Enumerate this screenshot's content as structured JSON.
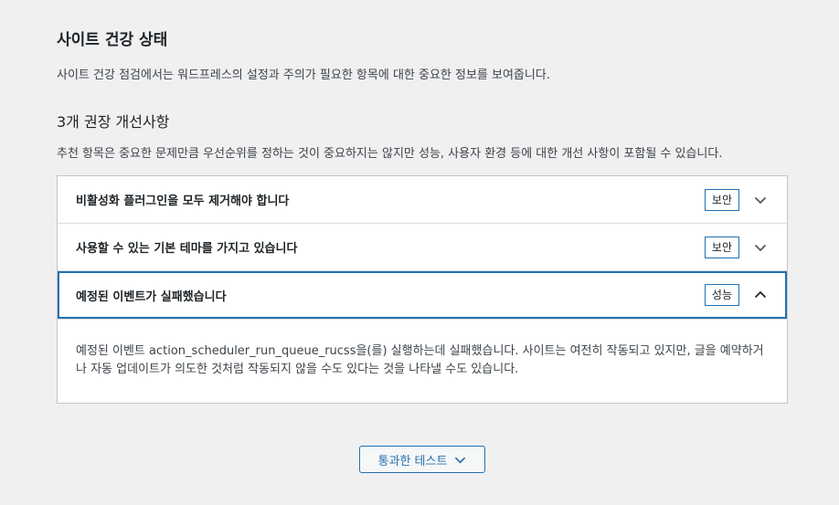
{
  "header": {
    "title": "사이트 건강 상태",
    "description": "사이트 건강 점검에서는 워드프레스의 설정과 주의가 필요한 항목에 대한 중요한 정보를 보여줍니다."
  },
  "recommended": {
    "title": "3개 권장 개선사항",
    "description": "추천 항목은 중요한 문제만큼 우선순위를 정하는 것이 중요하지는 않지만 성능, 사용자 환경 등에 대한 개선 사항이 포함될 수 있습니다.",
    "items": [
      {
        "title": "비활성화 플러그인을 모두 제거해야 합니다",
        "badge": "보안",
        "expanded": false
      },
      {
        "title": "사용할 수 있는 기본 테마를 가지고 있습니다",
        "badge": "보안",
        "expanded": false
      },
      {
        "title": "예정된 이벤트가 실패했습니다",
        "badge": "성능",
        "expanded": true,
        "body": "예정된 이벤트 action_scheduler_run_queue_rucss을(를) 실행하는데 실패했습니다. 사이트는 여전히 작동되고 있지만, 글을 예약하거나 자동 업데이트가 의도한 것처럼 작동되지 않을 수도 있다는 것을 나타낼 수도 있습니다."
      }
    ]
  },
  "footer": {
    "passed_tests_label": "통과한 테스트"
  },
  "icons": {
    "collapsed": "chevron-down-icon",
    "expanded": "chevron-up-icon"
  },
  "colors": {
    "accent": "#2271b1",
    "background": "#f0f0f1",
    "panel": "#ffffff",
    "border": "#c3c4c7"
  }
}
